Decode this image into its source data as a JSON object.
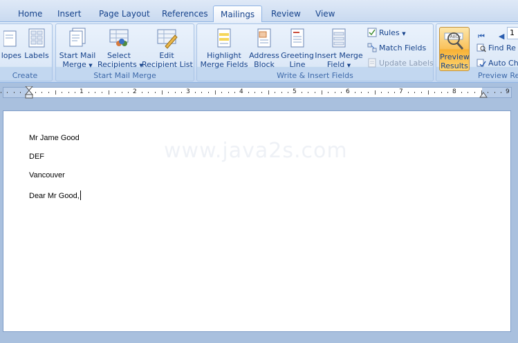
{
  "tabs": [
    {
      "label": "Home"
    },
    {
      "label": "Insert"
    },
    {
      "label": "Page Layout"
    },
    {
      "label": "References"
    },
    {
      "label": "Mailings"
    },
    {
      "label": "Review"
    },
    {
      "label": "View"
    }
  ],
  "ribbon": {
    "create": {
      "label": "Create",
      "envelopes": "lopes",
      "labels": "Labels"
    },
    "start_mail_merge": {
      "label": "Start Mail Merge",
      "start_line1": "Start Mail",
      "start_line2": "Merge",
      "select_line1": "Select",
      "select_line2": "Recipients",
      "edit_line1": "Edit",
      "edit_line2": "Recipient List"
    },
    "write_insert": {
      "label": "Write & Insert Fields",
      "highlight_line1": "Highlight",
      "highlight_line2": "Merge Fields",
      "address_line1": "Address",
      "address_line2": "Block",
      "greeting_line1": "Greeting",
      "greeting_line2": "Line",
      "insert_line1": "Insert Merge",
      "insert_line2": "Field",
      "rules": "Rules",
      "match": "Match Fields",
      "update": "Update Labels"
    },
    "preview": {
      "label": "Preview Res",
      "preview_line1": "Preview",
      "preview_line2": "Results",
      "record": "1",
      "find": "Find Re",
      "auto": "Auto Ch"
    }
  },
  "ruler": {
    "numbers": [
      "1",
      "2",
      "3",
      "4",
      "5",
      "6",
      "7",
      "8",
      "9"
    ]
  },
  "document": {
    "watermark": "www.java2s.com",
    "lines": [
      "Mr Jame Good",
      "DEF",
      "Vancouver",
      "Dear Mr Good,"
    ]
  },
  "colors": {
    "accent": "#15428b",
    "ribbon_bg": "#d3e2f5",
    "preview_active": "#f9c15a"
  }
}
